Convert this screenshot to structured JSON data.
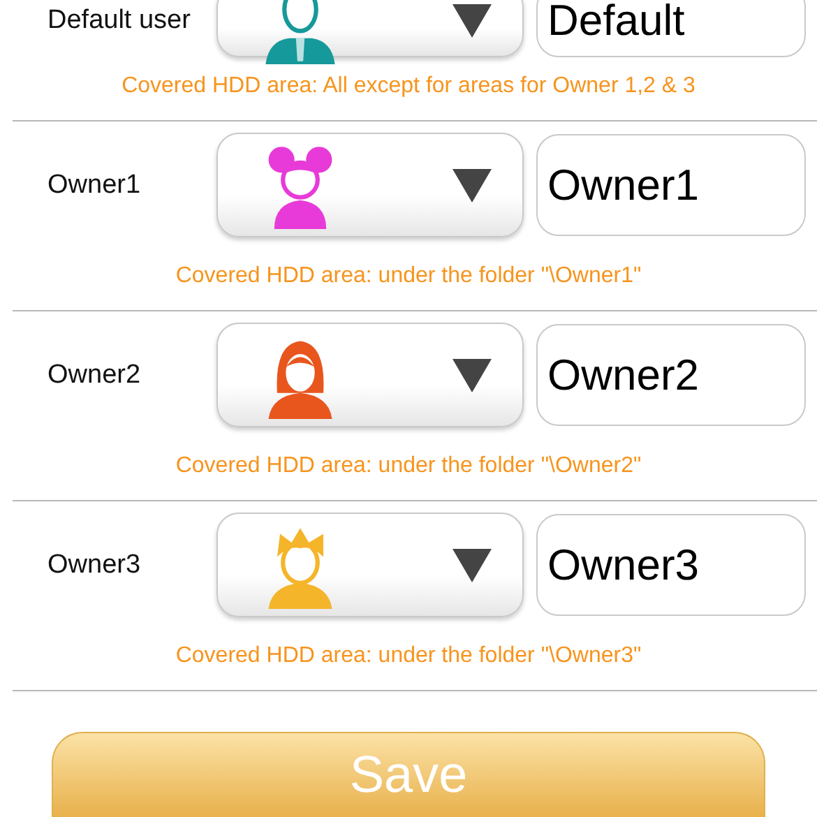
{
  "users": [
    {
      "label": "Default user",
      "avatar": {
        "kind": "man",
        "color": "#16999a"
      },
      "name": "Default",
      "note": "Covered HDD area: All except for areas for Owner 1,2 & 3"
    },
    {
      "label": "Owner1",
      "avatar": {
        "kind": "girl",
        "color": "#e83ad8"
      },
      "name": "Owner1",
      "note": "Covered HDD area: under the folder \"\\Owner1\""
    },
    {
      "label": "Owner2",
      "avatar": {
        "kind": "woman",
        "color": "#e8561e"
      },
      "name": "Owner2",
      "note": "Covered HDD area: under the folder \"\\Owner2\""
    },
    {
      "label": "Owner3",
      "avatar": {
        "kind": "boy",
        "color": "#f4b52a"
      },
      "name": "Owner3",
      "note": "Covered HDD area: under the folder \"\\Owner3\""
    }
  ],
  "save_button": "Save"
}
